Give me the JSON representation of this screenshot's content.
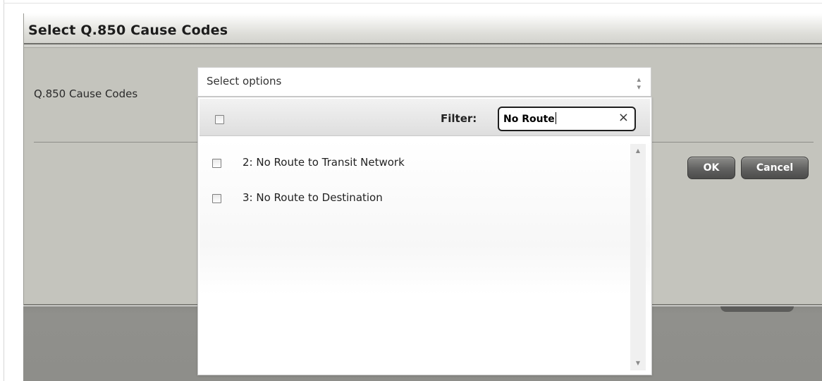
{
  "dialog": {
    "title": "Select Q.850 Cause Codes",
    "field_label": "Q.850 Cause Codes",
    "ok_label": "OK",
    "cancel_label": "Cancel"
  },
  "multiselect": {
    "button_text": "Select options",
    "arrows_icon": "sort-arrows-icon",
    "filter_label": "Filter:",
    "filter_value": "No Route",
    "clear_glyph": "×",
    "items": [
      {
        "label": "2: No Route to Transit Network",
        "checked": false
      },
      {
        "label": "3: No Route to Destination",
        "checked": false
      }
    ]
  },
  "colors": {
    "dialog_bg": "#c4c4bd",
    "button_dark": "#616160",
    "backdrop": "#8e8e8a"
  }
}
